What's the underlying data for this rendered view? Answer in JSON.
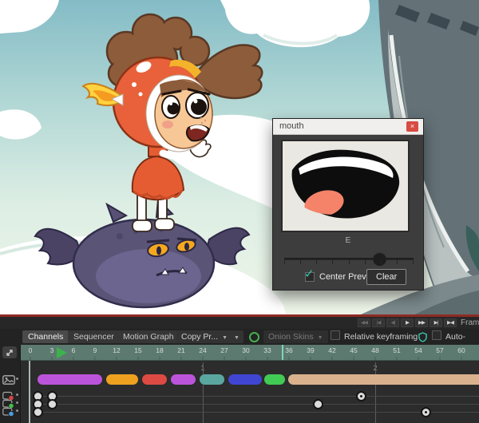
{
  "panel": {
    "title": "mouth",
    "close_label": "×",
    "phoneme_label": "E",
    "slider": {
      "value_pct": 74,
      "ticks": 9
    },
    "center_preview_label": "Center Preview",
    "center_preview_checked": true,
    "check_glyph": "✓",
    "clear_label": "Clear"
  },
  "transport": {
    "buttons": [
      {
        "glyph": "◀◀",
        "enabled": false
      },
      {
        "glyph": "|◀",
        "enabled": false
      },
      {
        "glyph": "◀|",
        "enabled": false
      },
      {
        "glyph": "▶",
        "enabled": true
      },
      {
        "glyph": "▶▶",
        "enabled": true
      },
      {
        "glyph": "▶|",
        "enabled": true
      },
      {
        "glyph": "▶◀",
        "enabled": true
      }
    ],
    "frame_label": "Frame"
  },
  "toolbar": {
    "tabs": [
      {
        "label": "Channels",
        "active": true
      },
      {
        "label": "Sequencer",
        "active": false
      },
      {
        "label": "Motion Graph",
        "active": false
      }
    ],
    "copy_dropdown": "Copy Pr...",
    "dropdown_arrow": "▼",
    "onion_dropdown": "Onion Skins",
    "relative_keyframing_label": "Relative keyframing",
    "relative_keyframing_checked": false,
    "auto_freeze_label": "Auto-freeze keys",
    "auto_freeze_checked": false
  },
  "timeline": {
    "ruler_labels": [
      0,
      3,
      6,
      9,
      12,
      15,
      18,
      21,
      24,
      27,
      30,
      33,
      36,
      39,
      42,
      45,
      48,
      51,
      54,
      57,
      60
    ],
    "playhead_frame": 0,
    "range_marker_frame": 35,
    "second_markers": [
      {
        "label": "1",
        "frame": 24
      },
      {
        "label": "2",
        "frame": 48
      }
    ],
    "bars": [
      {
        "start": 1,
        "end": 10,
        "color": "#bb54da"
      },
      {
        "start": 10.5,
        "end": 15,
        "color": "#eea11f"
      },
      {
        "start": 15.5,
        "end": 19,
        "color": "#dd4a43"
      },
      {
        "start": 19.5,
        "end": 23,
        "color": "#bb54da"
      },
      {
        "start": 23.6,
        "end": 27,
        "color": "#5aa7a0"
      },
      {
        "start": 27.6,
        "end": 32.2,
        "color": "#4046d2"
      },
      {
        "start": 32.6,
        "end": 35.4,
        "color": "#41cb55"
      },
      {
        "start": 35.9,
        "end": 63.2,
        "color": "#d9b28d"
      }
    ],
    "channel_rows": [
      {
        "color": "#d94343",
        "keys": [
          {
            "f": 1,
            "t": "solid"
          },
          {
            "f": 3,
            "t": "solid"
          },
          {
            "f": 46,
            "t": "ring"
          }
        ]
      },
      {
        "color": "#3fbe4a",
        "keys": [
          {
            "f": 1,
            "t": "solid"
          },
          {
            "f": 3,
            "t": "solid"
          },
          {
            "f": 40,
            "t": "solid"
          }
        ]
      },
      {
        "color": "#4a9ee0",
        "keys": [
          {
            "f": 1,
            "t": "solid"
          },
          {
            "f": 55,
            "t": "ring"
          }
        ]
      }
    ]
  }
}
